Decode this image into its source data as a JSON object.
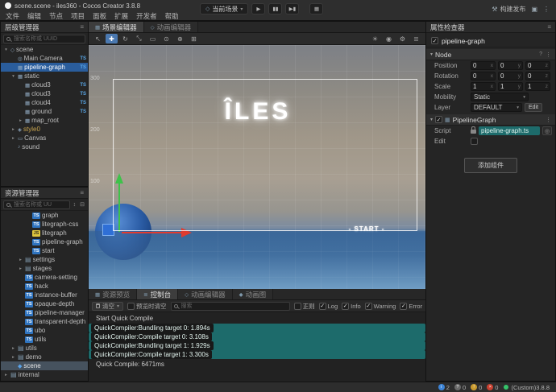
{
  "colors": {
    "accent": "#4a90d9",
    "hierarchy_selection": "#2a5d9c",
    "asset_selection": "#46525e",
    "ts_badge": "#2f74c0",
    "js_badge": "#dfc63e",
    "script_chip": "#1d6b6b",
    "version_dot": "#35c46a",
    "gizmo_green": "#3ec24a",
    "gizmo_red": "#e03b2f"
  },
  "titlebar": {
    "title": "scene.scene - iles360 - Cocos Creator 3.8.8",
    "scene_selector": "当前场景",
    "build_label": "构建发布"
  },
  "menubar": [
    "文件",
    "编辑",
    "节点",
    "项目",
    "面板",
    "扩展",
    "开发者",
    "帮助"
  ],
  "hierarchy": {
    "title": "层级管理器",
    "search_placeholder": "搜索名称或 UUID",
    "nodes": [
      {
        "label": "scene",
        "indent": 0,
        "arrow": "down",
        "icon": "scene"
      },
      {
        "label": "Main Camera",
        "indent": 1,
        "icon": "camera",
        "badge": "TS"
      },
      {
        "label": "pipeline-graph",
        "indent": 1,
        "icon": "node",
        "badge": "TS",
        "selected": true
      },
      {
        "label": "static",
        "indent": 1,
        "arrow": "down",
        "icon": "node"
      },
      {
        "label": "cloud3",
        "indent": 2,
        "icon": "node",
        "badge": "TS"
      },
      {
        "label": "cloud3",
        "indent": 2,
        "icon": "node",
        "badge": "TS"
      },
      {
        "label": "cloud4",
        "indent": 2,
        "icon": "node",
        "badge": "TS"
      },
      {
        "label": "ground",
        "indent": 2,
        "icon": "node",
        "badge": "TS"
      },
      {
        "label": "map_root",
        "indent": 2,
        "arrow": "right",
        "icon": "node"
      },
      {
        "label": "style0",
        "indent": 1,
        "arrow": "right",
        "icon": "prefab",
        "color": "#c8a44f"
      },
      {
        "label": "Canvas",
        "indent": 1,
        "arrow": "right",
        "icon": "canvas"
      },
      {
        "label": "sound",
        "indent": 1,
        "icon": "sound"
      }
    ]
  },
  "assets": {
    "title": "资源管理器",
    "search_placeholder": "搜索名称或 UU",
    "items": [
      {
        "label": "graph",
        "type": "ts",
        "indent": 3
      },
      {
        "label": "litegraph-css",
        "type": "ts",
        "indent": 3
      },
      {
        "label": "litegraph",
        "type": "js",
        "indent": 3
      },
      {
        "label": "pipeline-graph",
        "type": "ts",
        "indent": 3
      },
      {
        "label": "start",
        "type": "ts",
        "indent": 3
      },
      {
        "label": "settings",
        "type": "folder",
        "arrow": "right",
        "indent": 2
      },
      {
        "label": "stages",
        "type": "folder",
        "arrow": "right",
        "indent": 2
      },
      {
        "label": "camera-setting",
        "type": "ts",
        "indent": 2
      },
      {
        "label": "hack",
        "type": "ts",
        "indent": 2
      },
      {
        "label": "instance-buffer",
        "type": "ts",
        "indent": 2
      },
      {
        "label": "opaque-depth",
        "type": "ts",
        "indent": 2
      },
      {
        "label": "pipeline-manager",
        "type": "ts",
        "indent": 2
      },
      {
        "label": "transparent-depth",
        "type": "ts",
        "indent": 2
      },
      {
        "label": "ubo",
        "type": "ts",
        "indent": 2
      },
      {
        "label": "utils",
        "type": "ts",
        "indent": 2
      },
      {
        "label": "utils",
        "type": "folder",
        "arrow": "right",
        "indent": 1
      },
      {
        "label": "demo",
        "type": "folder",
        "arrow": "right",
        "indent": 1
      },
      {
        "label": "scene",
        "type": "scene-asset",
        "indent": 1,
        "selected": true
      },
      {
        "label": "internal",
        "type": "folder",
        "arrow": "right",
        "indent": 0
      }
    ]
  },
  "center": {
    "tabs": [
      {
        "label": "场景编辑器",
        "icon": "tab-scene",
        "active": true
      },
      {
        "label": "动画编辑器",
        "icon": "tab-anim"
      }
    ],
    "toolbar": {
      "tools": [
        {
          "name": "select-tool",
          "icon": "cursor"
        },
        {
          "name": "move-tool",
          "icon": "move",
          "active": true
        },
        {
          "name": "rotate-tool",
          "icon": "rotate"
        },
        {
          "name": "scale-tool",
          "icon": "scale"
        },
        {
          "name": "rect-tool",
          "icon": "rect"
        },
        {
          "name": "pivot-toggle",
          "icon": "pivot"
        },
        {
          "name": "space-toggle",
          "icon": "global"
        },
        {
          "name": "snap-toggle",
          "icon": "snap"
        }
      ],
      "right_tools": [
        {
          "name": "lighting-toggle",
          "icon": "light"
        },
        {
          "name": "camera-settings",
          "icon": "camera2"
        },
        {
          "name": "gizmo-settings",
          "icon": "gear"
        },
        {
          "name": "view-filter",
          "icon": "filter"
        }
      ]
    },
    "scene": {
      "game_title": "ÎLES",
      "start_label": "- START -",
      "ruler_labels": [
        "300",
        "200",
        "100"
      ]
    }
  },
  "inspector": {
    "title": "属性检查器",
    "node_name": "pipeline-graph",
    "node_section": "Node",
    "position_label": "Position",
    "rotation_label": "Rotation",
    "scale_label": "Scale",
    "axis": {
      "x": "x",
      "y": "y",
      "z": "z"
    },
    "position": {
      "x": "0",
      "y": "0",
      "z": "0"
    },
    "rotation": {
      "x": "0",
      "y": "0",
      "z": "0"
    },
    "scale": {
      "x": "1",
      "y": "1",
      "z": "1"
    },
    "mobility_label": "Mobility",
    "mobility_value": "Static",
    "layer_label": "Layer",
    "layer_value": "DEFAULT",
    "layer_edit_label": "Edit",
    "component_name": "PipelineGraph",
    "script_label": "Script",
    "script_value": "pipeline-graph.ts",
    "edit_label": "Edit",
    "add_component_label": "添加组件"
  },
  "bottom": {
    "tabs": [
      {
        "label": "资源预览",
        "icon": "tab-preview"
      },
      {
        "label": "控制台",
        "icon": "tab-console",
        "active": true
      },
      {
        "label": "动画编辑器",
        "icon": "tab-anim"
      },
      {
        "label": "动画图",
        "icon": "tab-animgraph"
      }
    ],
    "toolbar": {
      "clear_label": "清空",
      "clear_on_preview_label": "预览时清空",
      "search_placeholder": "搜索",
      "regex_label": "正则",
      "filters": [
        {
          "label": "Log",
          "checked": true
        },
        {
          "label": "Info",
          "checked": true
        },
        {
          "label": "Warning",
          "checked": true
        },
        {
          "label": "Error",
          "checked": true
        }
      ]
    },
    "logs": [
      {
        "text": "Start Quick Compile",
        "chip": false
      },
      {
        "text": "QuickCompiler:Bundling target 0: 1.894s",
        "chip": true
      },
      {
        "text": "QuickCompiler:Compile target 0: 3.108s",
        "chip": true
      },
      {
        "text": "QuickCompiler:Bundling target 1: 1.929s",
        "chip": true
      },
      {
        "text": "QuickCompiler:Compile target 1: 3.300s",
        "chip": true
      },
      {
        "text": "Quick Compile: 6471ms",
        "chip": false
      }
    ]
  },
  "statusbar": {
    "counters": [
      {
        "name": "info",
        "value": "2"
      },
      {
        "name": "question",
        "value": "0"
      },
      {
        "name": "warning",
        "value": "0"
      },
      {
        "name": "error",
        "value": "0"
      }
    ],
    "version": "(Custom)3.8.8"
  }
}
